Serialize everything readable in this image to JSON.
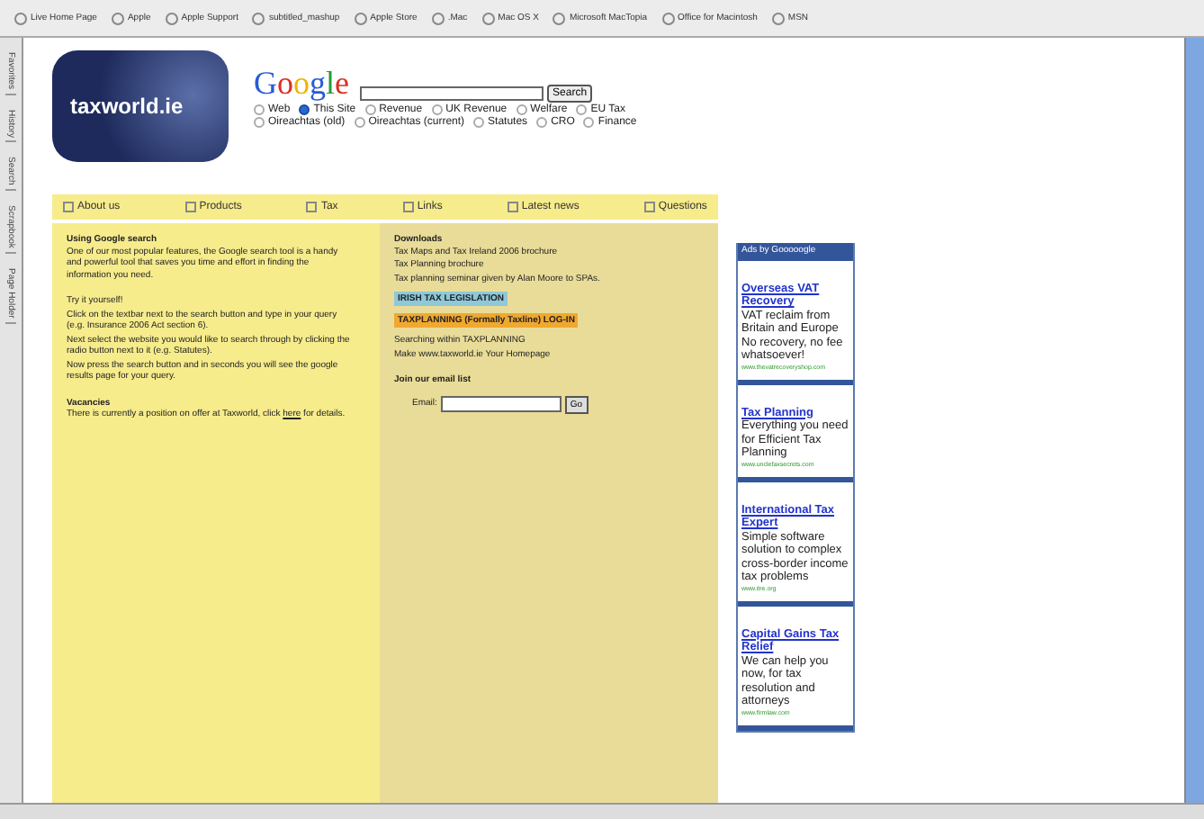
{
  "bookmarks": [
    "Live Home Page",
    "Apple",
    "Apple Support",
    "subtitled_mashup",
    "Apple Store",
    ".Mac",
    "Mac OS X",
    "Microsoft MacTopia",
    "Office for Macintosh",
    "MSN"
  ],
  "sidebar_tabs": [
    {
      "label": "Favorites",
      "selected": false
    },
    {
      "label": "History",
      "selected": false
    },
    {
      "label": "Search",
      "selected": false
    },
    {
      "label": "Scrapbook",
      "selected": false
    },
    {
      "label": "Page Holder",
      "selected": false
    }
  ],
  "logo": {
    "text": "taxworld.ie"
  },
  "google": {
    "logo": "Google",
    "button": "Search",
    "scopes": [
      [
        {
          "label": "Web",
          "selected": false
        },
        {
          "label": "This Site",
          "selected": true
        },
        {
          "label": "Revenue",
          "selected": false
        },
        {
          "label": "UK Revenue",
          "selected": false
        },
        {
          "label": "Welfare",
          "selected": false
        },
        {
          "label": "EU Tax",
          "selected": false
        }
      ],
      [
        {
          "label": "Oireachtas (old)",
          "selected": false
        },
        {
          "label": "Oireachtas (current)",
          "selected": false
        },
        {
          "label": "Statutes",
          "selected": false
        },
        {
          "label": "CRO",
          "selected": false
        },
        {
          "label": "Finance",
          "selected": false
        }
      ]
    ]
  },
  "nav": [
    "About us",
    "Products",
    "Tax",
    "Links",
    "Latest news",
    "Questions"
  ],
  "left": [
    {
      "kind": "heading",
      "text": "Using Google search"
    },
    {
      "kind": "para",
      "text": "One of our most popular features, the Google search tool is a handy and powerful tool that saves you time and effort in finding the information you need."
    },
    {
      "kind": "gap"
    },
    {
      "kind": "para",
      "text": "Try it yourself!"
    },
    {
      "kind": "para",
      "text": "Click on the textbar next to the search button and type in your query (e.g. Insurance 2006 Act section 6)."
    },
    {
      "kind": "para",
      "text": "Next select the website you would like to search through by clicking the radio button next to it (e.g. Statutes)."
    },
    {
      "kind": "para",
      "text": "Now press the search button and in seconds you will see the google results page for your query."
    },
    {
      "kind": "gap"
    },
    {
      "kind": "heading",
      "text": "Vacancies"
    },
    {
      "kind": "link_para",
      "text": "There is currently a position on offer at Taxworld, click",
      "link": "here",
      "after": "for details."
    }
  ],
  "middle": [
    {
      "kind": "heading",
      "text": "Downloads"
    },
    {
      "kind": "para",
      "text": "Tax Maps and Tax Ireland 2006 brochure"
    },
    {
      "kind": "para",
      "text": "Tax Planning brochure"
    },
    {
      "kind": "para",
      "text": "Tax planning seminar given by Alan Moore to SPAs."
    },
    {
      "kind": "highlight",
      "text": "IRISH TAX LEGISLATION",
      "color": "#8fc8d8"
    },
    {
      "kind": "highlight",
      "text": "TAXPLANNING (Formally Taxline) LOG-IN",
      "color": "#f0a830"
    },
    {
      "kind": "para",
      "text": "Searching within TAXPLANNING"
    },
    {
      "kind": "para",
      "text": "Make www.taxworld.ie Your Homepage"
    },
    {
      "kind": "gap"
    },
    {
      "kind": "heading",
      "text": "Join our email list"
    }
  ],
  "email": {
    "label": "Email:",
    "button": "Go"
  },
  "ads": {
    "header": "Ads by Gooooogle",
    "items": [
      {
        "title": "Overseas VAT Recovery",
        "body": "VAT reclaim from Britain and Europe No recovery, no fee whatsoever!",
        "url": "www.thevatrecoveryshop.com"
      },
      {
        "title": "Tax Planning",
        "body": "Everything you need for Efficient Tax Planning",
        "url": "www.unclefaxsecrets.com"
      },
      {
        "title": "International Tax Expert",
        "body": "Simple software solution to complex cross-border income tax problems",
        "url": "www.itre.org"
      },
      {
        "title": "Capital Gains Tax Relief",
        "body": "We can help you now, for tax resolution and attorneys",
        "url": "www.firmlaw.com"
      }
    ]
  }
}
